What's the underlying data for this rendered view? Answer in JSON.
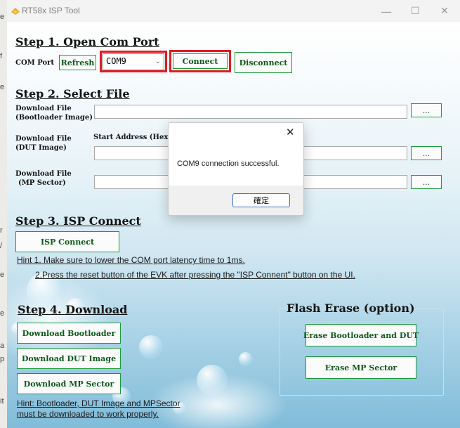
{
  "window": {
    "title": "RT58x ISP Tool",
    "controls": {
      "minimize": "—",
      "maximize": "☐",
      "close": "✕"
    }
  },
  "step1": {
    "heading": "Step 1. Open Com Port",
    "com_port_label": "COM Port",
    "refresh_label": "Refresh",
    "com_port_value": "COM9",
    "connect_label": "Connect",
    "disconnect_label": "Disconnect"
  },
  "step2": {
    "heading": "Step 2. Select File",
    "bootloader_label_line1": "Download File",
    "bootloader_label_line2": "(Bootloader Image)",
    "start_address_label": "Start Address (Hex)",
    "dut_label_line1": "Download File",
    "dut_label_line2": "(DUT Image)",
    "mp_label_line1": "Download File",
    "mp_label_line2": "(MP Sector)",
    "browse_label": "..."
  },
  "step3": {
    "heading": "Step 3. ISP Connect",
    "isp_connect_label": "ISP Connect",
    "hint1": "Hint 1. Make sure to lower the COM port latency time to 1ms.",
    "hint2": "2.Press the reset button of the EVK after pressing the \"ISP Connent\" button on the UI."
  },
  "step4": {
    "heading": "Step 4. Download",
    "download_bootloader_label": "Download Bootloader",
    "download_dut_label": "Download DUT Image",
    "download_mp_label": "Download MP Sector",
    "hint_line1": "Hint:  Bootloader, DUT Image and MPSector",
    "hint_line2": "must be downloaded to work properly."
  },
  "flash_erase": {
    "title": "Flash Erase (option)",
    "erase_bootloader_dut_label": "Erase Bootloader and DUT",
    "erase_mp_label": "Erase MP Sector"
  },
  "dialog": {
    "message": "COM9 connection successful.",
    "ok_label": "確定",
    "close_glyph": "✕"
  },
  "background_letters": [
    "e",
    "f",
    "e",
    "r",
    "/",
    "e",
    "e",
    "a",
    "p",
    "it"
  ],
  "colors": {
    "button_border": "#1a9b3a",
    "button_text": "#0c5a18",
    "highlight_red": "#e31b23",
    "dialog_ok_border": "#3a6fd8"
  }
}
